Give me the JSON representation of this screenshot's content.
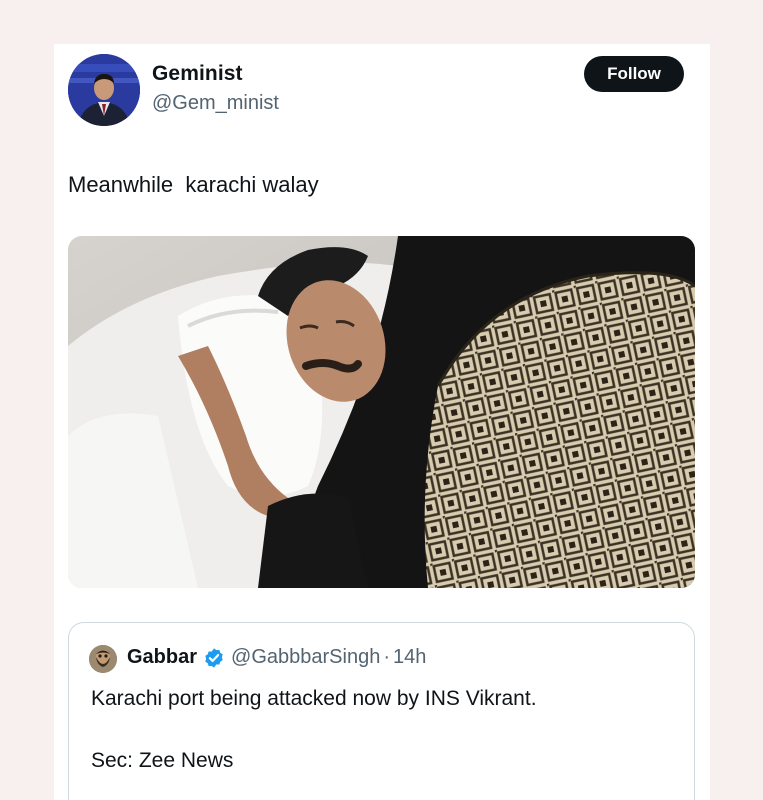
{
  "author": {
    "display_name": "Geminist",
    "handle": "@Gem_minist",
    "avatar_icon": "news-anchor-avatar"
  },
  "follow_button": {
    "label": "Follow"
  },
  "tweet": {
    "text": "Meanwhile  karachi walay",
    "media_icon": "sleeping-man-photo"
  },
  "quoted_tweet": {
    "display_name": "Gabbar",
    "verified": true,
    "verified_color": "#1d9bf0",
    "handle": "@GabbbarSingh",
    "separator": "·",
    "time": "14h",
    "text": "Karachi port being attacked now by INS Vikrant.",
    "source": "Sec: Zee News"
  },
  "colors": {
    "page_background": "#f8f0ef",
    "text_primary": "#0f1419",
    "text_secondary": "#536471",
    "button_background": "#0f1419"
  }
}
